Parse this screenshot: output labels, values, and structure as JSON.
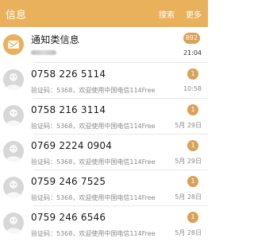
{
  "header": {
    "title": "信息",
    "search_label": "搜索",
    "more_label": "更多",
    "color": "#e9b15c"
  },
  "notification": {
    "name": "通知类信息",
    "badge": "892",
    "time": "21:04",
    "icon": "message-envelope-icon",
    "color": "#e9b15c"
  },
  "threads": [
    {
      "name": "0758 226 5114",
      "preview": "验证码：5368，欢迎使用中国电信114Free",
      "badge": "1",
      "time": "10:58"
    },
    {
      "name": "0758 216 3114",
      "preview": "验证码：5368，欢迎使用中国电信114Free",
      "badge": "1",
      "time": "5月 29日"
    },
    {
      "name": "0769 2224 0904",
      "preview": "验证码：5368，欢迎使用中国电信114Free",
      "badge": "1",
      "time": "5月 29日"
    },
    {
      "name": "0759 246 7525",
      "preview": "验证码：5368，欢迎使用中国电信114Free",
      "badge": "1",
      "time": "5月 28日"
    },
    {
      "name": "0759 246 6546",
      "preview": "验证码：5368，欢迎使用中国电信114Free",
      "badge": "1",
      "time": "5月 28日"
    }
  ],
  "badge_color": "#dba158"
}
